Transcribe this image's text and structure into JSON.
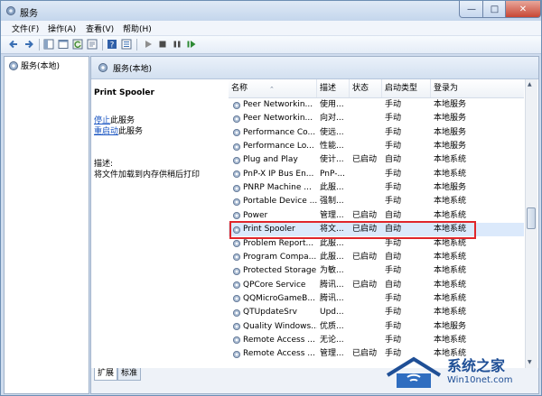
{
  "window": {
    "title": "服务",
    "min_glyph": "—",
    "max_glyph": "□",
    "close_glyph": "✕"
  },
  "menu": {
    "items": [
      "文件(F)",
      "操作(A)",
      "查看(V)",
      "帮助(H)"
    ]
  },
  "toolbar": {
    "icons": [
      "back-arrow-icon",
      "forward-arrow-icon",
      "show-tree-icon",
      "console-icon",
      "refresh-icon",
      "export-icon",
      "help-icon",
      "properties-icon",
      "start-icon",
      "stop-icon",
      "pause-icon",
      "restart-icon"
    ]
  },
  "tree": {
    "root_label": "服务(本地)"
  },
  "pane": {
    "header_title": "服务(本地)"
  },
  "detail": {
    "service_name": "Print Spooler",
    "stop_link": "停止",
    "stop_suffix": "此服务",
    "restart_link": "重启动",
    "restart_suffix": "此服务",
    "desc_label": "描述:",
    "desc_text": "将文件加载到内存供稍后打印"
  },
  "list": {
    "columns": [
      "名称",
      "描述",
      "状态",
      "启动类型",
      "登录为"
    ],
    "rows": [
      [
        "Peer Networkin...",
        "使用...",
        "",
        "手动",
        "本地服务"
      ],
      [
        "Peer Networkin...",
        "向对...",
        "",
        "手动",
        "本地服务"
      ],
      [
        "Performance Co...",
        "使远...",
        "",
        "手动",
        "本地服务"
      ],
      [
        "Performance Lo...",
        "性能...",
        "",
        "手动",
        "本地服务"
      ],
      [
        "Plug and Play",
        "使计...",
        "已启动",
        "自动",
        "本地系统"
      ],
      [
        "PnP-X IP Bus En...",
        "PnP-...",
        "",
        "手动",
        "本地系统"
      ],
      [
        "PNRP Machine ...",
        "此服...",
        "",
        "手动",
        "本地服务"
      ],
      [
        "Portable Device ...",
        "强制...",
        "",
        "手动",
        "本地系统"
      ],
      [
        "Power",
        "管理...",
        "已启动",
        "自动",
        "本地系统"
      ],
      [
        "Print Spooler",
        "将文...",
        "已启动",
        "自动",
        "本地系统"
      ],
      [
        "Problem Report...",
        "此服...",
        "",
        "手动",
        "本地系统"
      ],
      [
        "Program Compa...",
        "此服...",
        "已启动",
        "自动",
        "本地系统"
      ],
      [
        "Protected Storage",
        "为敏...",
        "",
        "手动",
        "本地系统"
      ],
      [
        "QPCore Service",
        "腾讯...",
        "已启动",
        "自动",
        "本地系统"
      ],
      [
        "QQMicroGameB...",
        "腾讯...",
        "",
        "手动",
        "本地系统"
      ],
      [
        "QTUpdateSrv",
        "Upd...",
        "",
        "手动",
        "本地系统"
      ],
      [
        "Quality Windows...",
        "优质...",
        "",
        "手动",
        "本地服务"
      ],
      [
        "Remote Access ...",
        "无论...",
        "",
        "手动",
        "本地系统"
      ],
      [
        "Remote Access ...",
        "管理...",
        "已启动",
        "手动",
        "本地系统"
      ]
    ],
    "selected_index": 9
  },
  "tabs": {
    "extended": "扩展",
    "standard": "标准"
  },
  "watermark": {
    "big": "系统之家",
    "small": "Win10net.com"
  },
  "colors": {
    "highlight": "#e0262a",
    "link": "#1a55c2",
    "brand": "#1f4f96"
  }
}
